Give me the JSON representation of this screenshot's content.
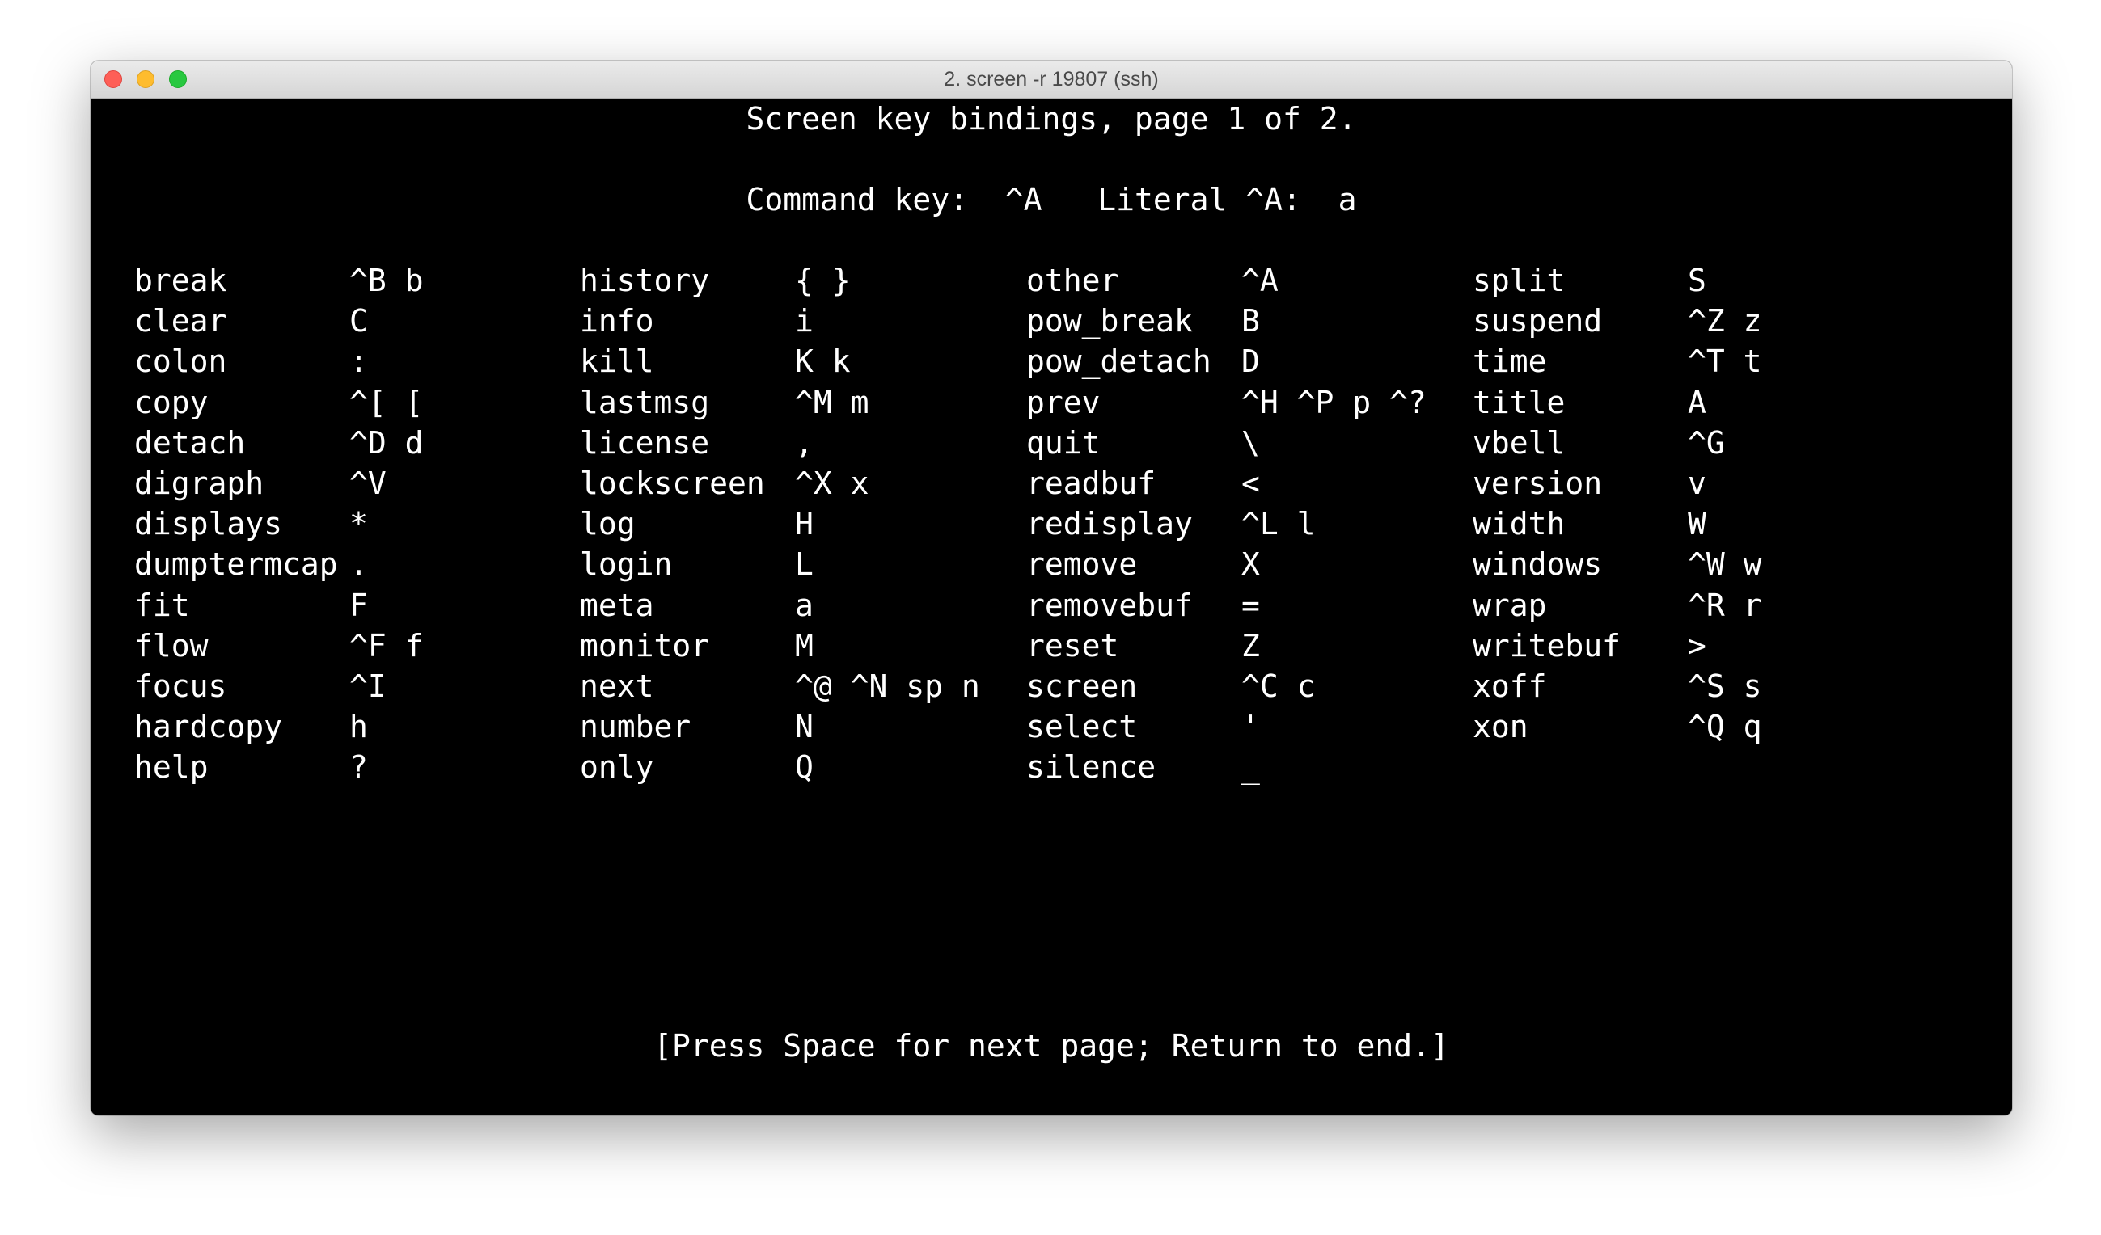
{
  "window": {
    "title": "2. screen -r 19807 (ssh)"
  },
  "terminal": {
    "header": "Screen key bindings, page 1 of 2.",
    "command_line": {
      "command_key_label": "Command key:",
      "command_key_value": "^A",
      "literal_label": "Literal ^A:",
      "literal_value": "a"
    },
    "columns": [
      [
        {
          "command": "break",
          "keys": "^B b"
        },
        {
          "command": "clear",
          "keys": "C"
        },
        {
          "command": "colon",
          "keys": ":"
        },
        {
          "command": "copy",
          "keys": "^[ ["
        },
        {
          "command": "detach",
          "keys": "^D d"
        },
        {
          "command": "digraph",
          "keys": "^V"
        },
        {
          "command": "displays",
          "keys": "*"
        },
        {
          "command": "dumptermcap",
          "keys": "."
        },
        {
          "command": "fit",
          "keys": "F"
        },
        {
          "command": "flow",
          "keys": "^F f"
        },
        {
          "command": "focus",
          "keys": "^I"
        },
        {
          "command": "hardcopy",
          "keys": "h"
        },
        {
          "command": "help",
          "keys": "?"
        }
      ],
      [
        {
          "command": "history",
          "keys": "{ }"
        },
        {
          "command": "info",
          "keys": "i"
        },
        {
          "command": "kill",
          "keys": "K k"
        },
        {
          "command": "lastmsg",
          "keys": "^M m"
        },
        {
          "command": "license",
          "keys": ","
        },
        {
          "command": "lockscreen",
          "keys": "^X x"
        },
        {
          "command": "log",
          "keys": "H"
        },
        {
          "command": "login",
          "keys": "L"
        },
        {
          "command": "meta",
          "keys": "a"
        },
        {
          "command": "monitor",
          "keys": "M"
        },
        {
          "command": "next",
          "keys": "^@ ^N sp n"
        },
        {
          "command": "number",
          "keys": "N"
        },
        {
          "command": "only",
          "keys": "Q"
        }
      ],
      [
        {
          "command": "other",
          "keys": "^A"
        },
        {
          "command": "pow_break",
          "keys": "B"
        },
        {
          "command": "pow_detach",
          "keys": "D"
        },
        {
          "command": "prev",
          "keys": "^H ^P p ^?"
        },
        {
          "command": "quit",
          "keys": "\\"
        },
        {
          "command": "readbuf",
          "keys": "<"
        },
        {
          "command": "redisplay",
          "keys": "^L l"
        },
        {
          "command": "remove",
          "keys": "X"
        },
        {
          "command": "removebuf",
          "keys": "="
        },
        {
          "command": "reset",
          "keys": "Z"
        },
        {
          "command": "screen",
          "keys": "^C c"
        },
        {
          "command": "select",
          "keys": "'"
        },
        {
          "command": "silence",
          "keys": "_"
        }
      ],
      [
        {
          "command": "split",
          "keys": "S"
        },
        {
          "command": "suspend",
          "keys": "^Z z"
        },
        {
          "command": "time",
          "keys": "^T t"
        },
        {
          "command": "title",
          "keys": "A"
        },
        {
          "command": "vbell",
          "keys": "^G"
        },
        {
          "command": "version",
          "keys": "v"
        },
        {
          "command": "width",
          "keys": "W"
        },
        {
          "command": "windows",
          "keys": "^W w"
        },
        {
          "command": "wrap",
          "keys": "^R r"
        },
        {
          "command": "writebuf",
          "keys": ">"
        },
        {
          "command": "xoff",
          "keys": "^S s"
        },
        {
          "command": "xon",
          "keys": "^Q q"
        }
      ]
    ],
    "footer": "[Press Space for next page; Return to end.]"
  },
  "colors": {
    "terminal_background": "#000000",
    "terminal_text": "#ffffff",
    "close": "#fe5f57",
    "minimize": "#febc2e",
    "zoom": "#28c840"
  }
}
